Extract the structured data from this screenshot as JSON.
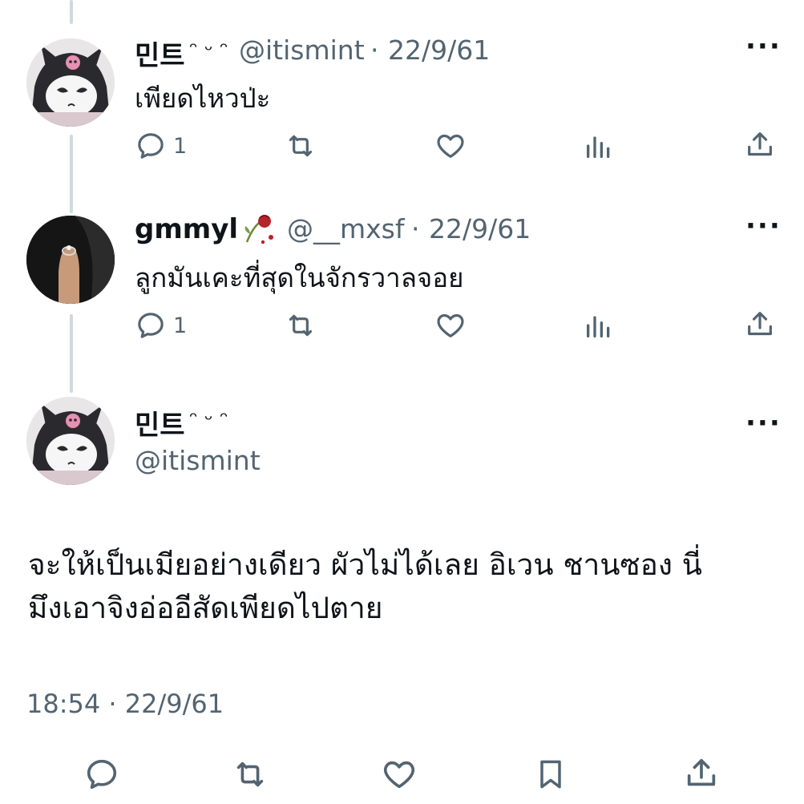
{
  "tweets": [
    {
      "name": "민트",
      "name_decoration": "ᵔ ᵕ ᵔ",
      "handle": "@itismint",
      "separator": "·",
      "date": "22/9/61",
      "text": "เพียดไหวป่ะ",
      "reply_count": "1",
      "avatar_icon": "kuromi-avatar-icon"
    },
    {
      "name": "gmmyl",
      "name_decoration": "wilted-rose-icon",
      "handle": "@__mxsf",
      "separator": "·",
      "date": "22/9/61",
      "text": "ลูกมันเคะที่สุดในจักรวาลจอย",
      "reply_count": "1",
      "avatar_icon": "finger-ring-avatar-icon"
    }
  ],
  "main_tweet": {
    "name": "민트",
    "name_decoration": "ᵔ ᵕ ᵔ",
    "handle": "@itismint",
    "text_line1": "จะให้เป็นเมียอย่างเดียว ผัวไม่ได้เลย อิเวน ชานซอง นี่",
    "text_line2": "มึงเอาจิงอ่ออีสัดเพียดไปตาย",
    "time": "18:54",
    "separator": "·",
    "date": "22/9/61"
  },
  "more_label": "···",
  "colors": {
    "text": "#0f1419",
    "muted": "#536471",
    "thread_line": "#cfd9de",
    "background": "#ffffff"
  }
}
